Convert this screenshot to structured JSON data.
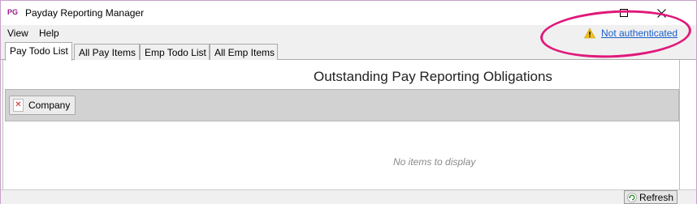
{
  "window": {
    "logo": "PG",
    "title": "Payday Reporting Manager"
  },
  "menu": {
    "items": [
      "View",
      "Help"
    ]
  },
  "auth": {
    "status_label": "Not authenticated",
    "icon": "warning-icon"
  },
  "tabs": [
    {
      "label": "Pay Todo List",
      "active": true
    },
    {
      "label": "All Pay Items",
      "active": false
    },
    {
      "label": "Emp Todo List",
      "active": false
    },
    {
      "label": "All Emp Items",
      "active": false
    }
  ],
  "main": {
    "heading": "Outstanding Pay Reporting Obligations",
    "group_chip_label": "Company",
    "empty_message": "No items to display"
  },
  "status": {
    "refresh_label": "Refresh"
  },
  "colors": {
    "highlight": "#e0197a",
    "link": "#1a5ec8",
    "logo": "#9a1a8a"
  }
}
